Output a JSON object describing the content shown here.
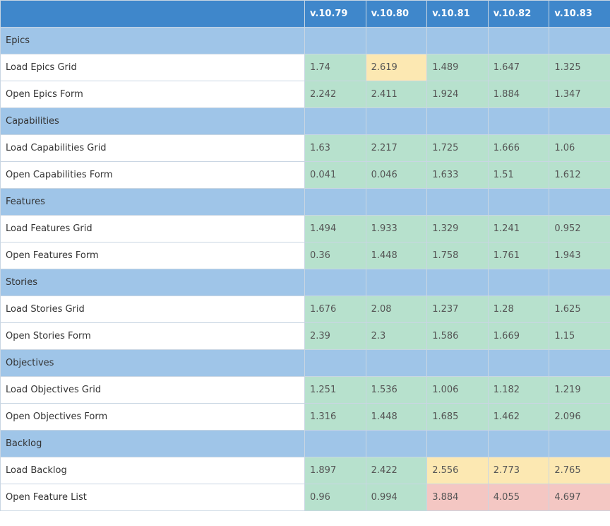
{
  "columns": [
    "v.10.79",
    "v.10.80",
    "v.10.81",
    "v.10.82",
    "v.10.83"
  ],
  "status_colors": {
    "good": "#b7e1cd",
    "warn": "#fce8b2",
    "bad": "#f4c7c3"
  },
  "groups": [
    {
      "name": "Epics",
      "rows": [
        {
          "label": "Load Epics Grid",
          "values": [
            "1.74",
            "2.619",
            "1.489",
            "1.647",
            "1.325"
          ],
          "status": [
            "good",
            "warn",
            "good",
            "good",
            "good"
          ]
        },
        {
          "label": "Open Epics Form",
          "values": [
            "2.242",
            "2.411",
            "1.924",
            "1.884",
            "1.347"
          ],
          "status": [
            "good",
            "good",
            "good",
            "good",
            "good"
          ]
        }
      ]
    },
    {
      "name": "Capabilities",
      "rows": [
        {
          "label": "Load Capabilities Grid",
          "values": [
            "1.63",
            "2.217",
            "1.725",
            "1.666",
            "1.06"
          ],
          "status": [
            "good",
            "good",
            "good",
            "good",
            "good"
          ]
        },
        {
          "label": "Open Capabilities Form",
          "values": [
            "0.041",
            "0.046",
            "1.633",
            "1.51",
            "1.612"
          ],
          "status": [
            "good",
            "good",
            "good",
            "good",
            "good"
          ]
        }
      ]
    },
    {
      "name": "Features",
      "rows": [
        {
          "label": "Load Features Grid",
          "values": [
            "1.494",
            "1.933",
            "1.329",
            "1.241",
            "0.952"
          ],
          "status": [
            "good",
            "good",
            "good",
            "good",
            "good"
          ]
        },
        {
          "label": "Open Features Form",
          "values": [
            "0.36",
            "1.448",
            "1.758",
            "1.761",
            "1.943"
          ],
          "status": [
            "good",
            "good",
            "good",
            "good",
            "good"
          ]
        }
      ]
    },
    {
      "name": "Stories",
      "rows": [
        {
          "label": "Load Stories Grid",
          "values": [
            "1.676",
            "2.08",
            "1.237",
            "1.28",
            "1.625"
          ],
          "status": [
            "good",
            "good",
            "good",
            "good",
            "good"
          ]
        },
        {
          "label": "Open Stories Form",
          "values": [
            "2.39",
            "2.3",
            "1.586",
            "1.669",
            "1.15"
          ],
          "status": [
            "good",
            "good",
            "good",
            "good",
            "good"
          ]
        }
      ]
    },
    {
      "name": "Objectives",
      "rows": [
        {
          "label": "Load Objectives Grid",
          "values": [
            "1.251",
            "1.536",
            "1.006",
            "1.182",
            "1.219"
          ],
          "status": [
            "good",
            "good",
            "good",
            "good",
            "good"
          ]
        },
        {
          "label": "Open Objectives Form",
          "values": [
            "1.316",
            "1.448",
            "1.685",
            "1.462",
            "2.096"
          ],
          "status": [
            "good",
            "good",
            "good",
            "good",
            "good"
          ]
        }
      ]
    },
    {
      "name": "Backlog",
      "rows": [
        {
          "label": "Load Backlog",
          "values": [
            "1.897",
            "2.422",
            "2.556",
            "2.773",
            "2.765"
          ],
          "status": [
            "good",
            "good",
            "warn",
            "warn",
            "warn"
          ]
        },
        {
          "label": "Open Feature List",
          "values": [
            "0.96",
            "0.994",
            "3.884",
            "4.055",
            "4.697"
          ],
          "status": [
            "good",
            "good",
            "bad",
            "bad",
            "bad"
          ]
        }
      ]
    }
  ]
}
